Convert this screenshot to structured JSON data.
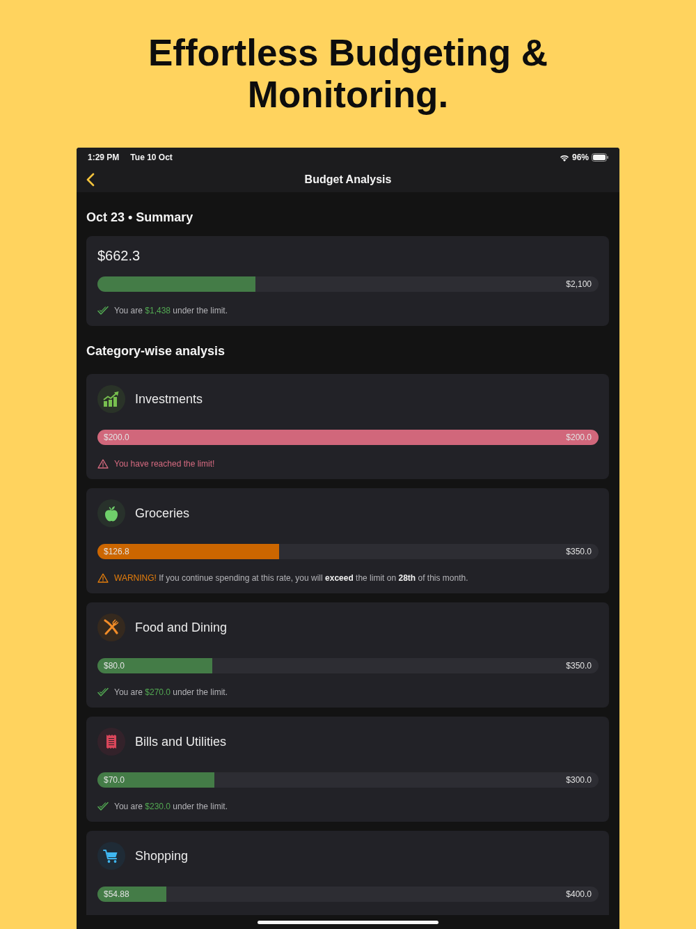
{
  "headline": "Effortless Budgeting & Monitoring.",
  "status_bar": {
    "time": "1:29 PM",
    "date": "Tue 10 Oct",
    "battery": "96%"
  },
  "nav": {
    "title": "Budget Analysis"
  },
  "summary": {
    "heading": "Oct 23 • Summary",
    "amount": "$662.3",
    "level": 0.315,
    "limit": "$2,100",
    "limit_reached": false,
    "warning": false,
    "message": [
      {
        "kind": "plain",
        "text": "You are"
      },
      {
        "kind": "highlight",
        "text": "$1,438"
      },
      {
        "kind": "plain",
        "text": "under the limit."
      }
    ]
  },
  "category_heading": "Category-wise analysis",
  "categories": [
    {
      "kind": "investments",
      "name": "Investments",
      "spent": "$200.0",
      "limit": "$200.0",
      "level": 1,
      "limit_reached": true,
      "warning": false,
      "message": [
        {
          "kind": "highlight",
          "text": "You have reached the limit!"
        }
      ]
    },
    {
      "kind": "groceries",
      "name": "Groceries",
      "spent": "$126.8",
      "limit": "$350.0",
      "level": 0.362,
      "limit_reached": false,
      "warning": true,
      "message": [
        {
          "kind": "highlight",
          "text": "WARNING!"
        },
        {
          "kind": "plain",
          "text": "If you continue spending at this rate, you will **exceed** the limit on **28th** of this month."
        }
      ]
    },
    {
      "kind": "dining",
      "name": "Food and Dining",
      "spent": "$80.0",
      "limit": "$350.0",
      "level": 0.229,
      "limit_reached": false,
      "warning": false,
      "message": [
        {
          "kind": "plain",
          "text": "You are"
        },
        {
          "kind": "highlight",
          "text": "$270.0"
        },
        {
          "kind": "plain",
          "text": "under the limit."
        }
      ]
    },
    {
      "kind": "bills",
      "name": "Bills and Utilities",
      "spent": "$70.0",
      "limit": "$300.0",
      "level": 0.233,
      "limit_reached": false,
      "warning": false,
      "message": [
        {
          "kind": "plain",
          "text": "You are"
        },
        {
          "kind": "highlight",
          "text": "$230.0"
        },
        {
          "kind": "plain",
          "text": "under the limit."
        }
      ]
    },
    {
      "kind": "shopping",
      "name": "Shopping",
      "spent": "$54.88",
      "limit": "$400.0",
      "level": 0.137,
      "limit_reached": false,
      "warning": false
    }
  ]
}
